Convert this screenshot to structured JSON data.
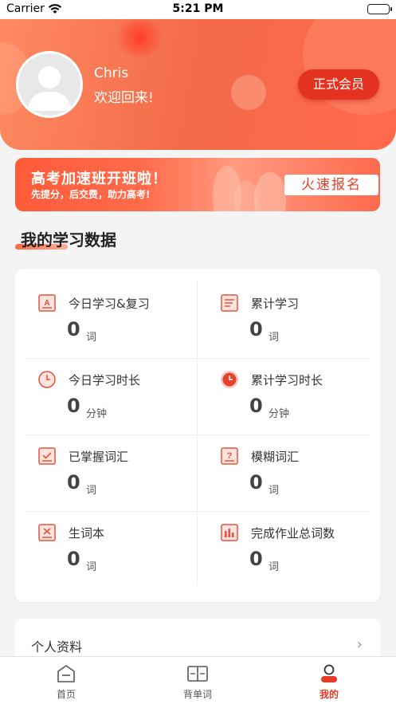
{
  "status_bar": {
    "carrier": "Carrier",
    "time": "5:21 PM"
  },
  "profile": {
    "name": "Chris",
    "welcome": "欢迎回来!",
    "member_badge": "正式会员"
  },
  "banner": {
    "title": "高考加速班开班啦！",
    "subtitle": "先提分，后交费，助力高考!",
    "button": "火速报名"
  },
  "section": {
    "title": "我的学习数据"
  },
  "stats": [
    {
      "icon": "study-review-icon",
      "label": "今日学习&复习",
      "value": "0",
      "unit": "词"
    },
    {
      "icon": "total-study-icon",
      "label": "累计学习",
      "value": "0",
      "unit": "词"
    },
    {
      "icon": "clock-icon",
      "label": "今日学习时长",
      "value": "0",
      "unit": "分钟"
    },
    {
      "icon": "clock-filled-icon",
      "label": "累计学习时长",
      "value": "0",
      "unit": "分钟"
    },
    {
      "icon": "mastered-icon",
      "label": "已掌握词汇",
      "value": "0",
      "unit": "词"
    },
    {
      "icon": "question-icon",
      "label": "模糊词汇",
      "value": "0",
      "unit": "词"
    },
    {
      "icon": "wrong-words-icon",
      "label": "生词本",
      "value": "0",
      "unit": "词"
    },
    {
      "icon": "homework-chart-icon",
      "label": "完成作业总词数",
      "value": "0",
      "unit": "词"
    }
  ],
  "menu": {
    "profile_label": "个人资料",
    "chevron": "›"
  },
  "tabbar": {
    "tabs": [
      {
        "icon": "home-icon",
        "label": "首页",
        "active": false
      },
      {
        "icon": "book-icon",
        "label": "背单词",
        "active": false
      },
      {
        "icon": "user-icon",
        "label": "我的",
        "active": true
      }
    ]
  },
  "colors": {
    "accent": "#f36a48",
    "active_tab": "#e43a26",
    "badge": "#e3321f"
  }
}
